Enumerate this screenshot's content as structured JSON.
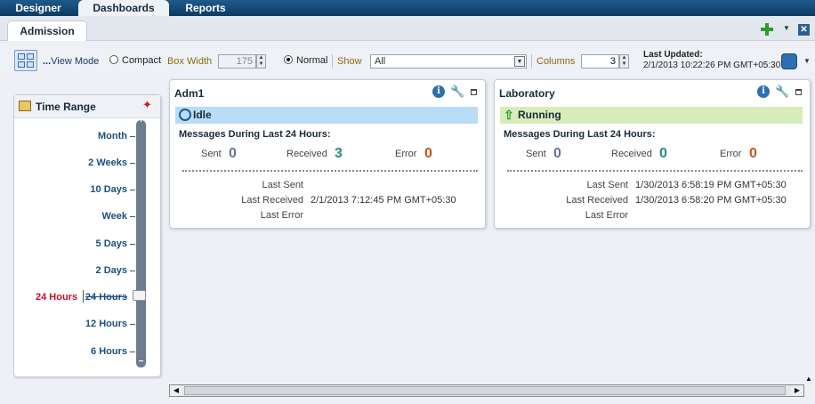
{
  "top_tabs": [
    "Designer",
    "Dashboards",
    "Reports"
  ],
  "sub_tab": "Admission",
  "toolbar": {
    "view_mode_label": "View Mode",
    "compact_label": "Compact",
    "box_width_label": "Box Width",
    "box_width_value": "175",
    "normal_label": "Normal",
    "show_label": "Show",
    "show_value": "All",
    "columns_label": "Columns",
    "columns_value": "3",
    "last_updated_label": "Last Updated:",
    "last_updated_value": "2/1/2013 10:22:26 PM GMT+05:30"
  },
  "time_range": {
    "title": "Time Range",
    "items": [
      "Month",
      "2 Weeks",
      "10 Days",
      "Week",
      "5 Days",
      "2 Days",
      "24 Hours",
      "12 Hours",
      "6 Hours"
    ],
    "selected_label": "24 Hours",
    "selected_index": 6
  },
  "cards": [
    {
      "title": "Adm1",
      "status": "Idle",
      "status_color": "#b9dcf7",
      "messages_title": "Messages During Last 24 Hours:",
      "sent_label": "Sent",
      "sent_value": "0",
      "received_label": "Received",
      "received_value": "3",
      "error_label": "Error",
      "error_value": "0",
      "last_sent_label": "Last Sent",
      "last_sent_value": "",
      "last_received_label": "Last Received",
      "last_received_value": "2/1/2013 7:12:45 PM GMT+05:30",
      "last_error_label": "Last Error",
      "last_error_value": ""
    },
    {
      "title": "Laboratory",
      "status": "Running",
      "status_color": "#d7ecb9",
      "messages_title": "Messages During Last 24 Hours:",
      "sent_label": "Sent",
      "sent_value": "0",
      "received_label": "Received",
      "received_value": "0",
      "error_label": "Error",
      "error_value": "0",
      "last_sent_label": "Last Sent",
      "last_sent_value": "1/30/2013 6:58:19 PM GMT+05:30",
      "last_received_label": "Last Received",
      "last_received_value": "1/30/2013 6:58:20 PM GMT+05:30",
      "last_error_label": "Last Error",
      "last_error_value": ""
    }
  ],
  "colors": {
    "sent": "#6a6fa0",
    "received": "#2a8a8a",
    "error": "#c8521c",
    "selected_range": "#c0102a"
  }
}
